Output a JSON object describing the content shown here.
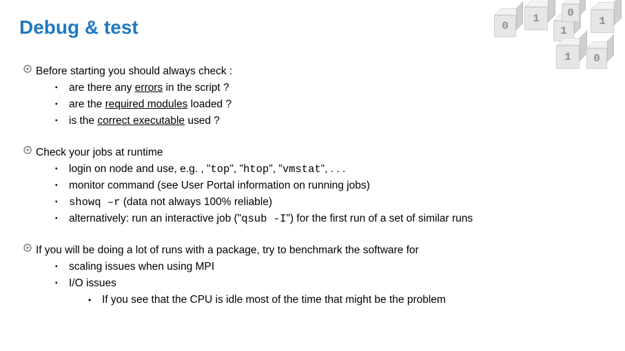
{
  "title": "Debug & test",
  "sections": [
    {
      "lead": "Before starting you should always check :",
      "subs": [
        {
          "pre": "are there any ",
          "u": "errors",
          "post": " in the script ?"
        },
        {
          "pre": "are the ",
          "u": "required modules",
          "post": " loaded ?"
        },
        {
          "pre": "is the ",
          "u": "correct executable",
          "post": " used ?"
        }
      ]
    },
    {
      "lead": "Check your jobs at runtime",
      "subs": [
        {
          "text_parts": [
            "login on node and use, e.g. , \"",
            {
              "mono": "top"
            },
            "\", \"",
            {
              "mono": "htop"
            },
            "\", \"",
            {
              "mono": "vmstat"
            },
            "\", . . ."
          ]
        },
        {
          "plain": "monitor command (see User Portal information on running jobs)"
        },
        {
          "text_parts": [
            {
              "mono": "showq –r"
            },
            " (data not always 100% reliable)"
          ]
        },
        {
          "text_parts": [
            "alternatively: run an interactive job (\"",
            {
              "mono": "qsub -I"
            },
            "\") for the first run of a set of similar runs"
          ]
        }
      ]
    },
    {
      "lead": "If you will be doing a lot of runs with a package, try to benchmark the software for",
      "subs": [
        {
          "plain": "scaling issues when using MPI"
        },
        {
          "plain": "I/O issues",
          "subsub": "If you see that the CPU is idle most of the time that might be the problem"
        }
      ]
    }
  ],
  "cubes": [
    "0",
    "1",
    "1",
    "0",
    "1",
    "1",
    "0"
  ]
}
